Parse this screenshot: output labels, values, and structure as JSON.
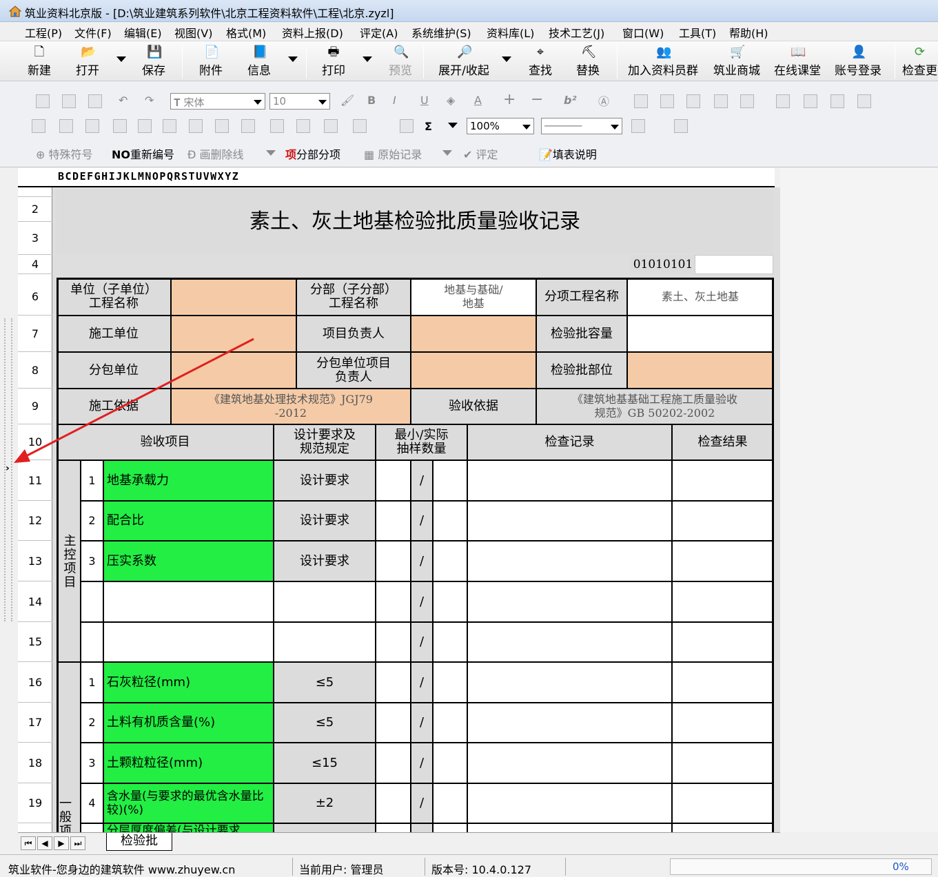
{
  "window": {
    "title": "筑业资料北京版 - [D:\\筑业建筑系列软件\\北京工程资料软件\\工程\\北京.zyzl]"
  },
  "menu": [
    "工程(P)",
    "文件(F)",
    "编辑(E)",
    "视图(V)",
    "格式(M)",
    "资料上报(D)",
    "评定(A)",
    "系统维护(S)",
    "资料库(L)",
    "技术工艺(J)",
    "窗口(W)",
    "工具(T)",
    "帮助(H)"
  ],
  "toolbar": {
    "new": "新建",
    "open": "打开",
    "save": "保存",
    "attach": "附件",
    "info": "信息",
    "print": "打印",
    "preview": "预览",
    "expand": "展开/收起",
    "find": "查找",
    "replace": "替换",
    "join": "加入资料员群",
    "mall": "筑业商城",
    "course": "在线课堂",
    "login": "账号登录",
    "check": "检查更"
  },
  "format": {
    "font": "宋体",
    "size": "10",
    "zoom": "100%",
    "special": "特殊符号",
    "renumber": "重新编号",
    "strike": "画删除线",
    "split": "分部分项",
    "raw": "原始记录",
    "evaluate": "评定",
    "fill": "填表说明",
    "renumber_icon": "NO",
    "split_icon": "项"
  },
  "sheet": {
    "column_letters": "BCDEFGHIJKLMNOPQRSTUVWXYZ",
    "rows": [
      "2",
      "3",
      "4",
      "6",
      "7",
      "8",
      "9",
      "10",
      "11",
      "12",
      "13",
      "14",
      "15",
      "16",
      "17",
      "18",
      "19"
    ],
    "title": "素土、灰土地基检验批质量验收记录",
    "code": "01010101",
    "unit_label": "单位（子单位）\n工程名称",
    "sub_label": "分部（子分部）\n工程名称",
    "sub_value": "地基与基础/\n地基",
    "item_label": "分项工程名称",
    "item_value": "素土、灰土地基",
    "constr_label": "施工单位",
    "pm_label": "项目负责人",
    "cap_label": "检验批容量",
    "subc_label": "分包单位",
    "subpm_label": "分包单位项目\n负责人",
    "pos_label": "检验批部位",
    "basis_label": "施工依据",
    "basis_value": "《建筑地基处理技术规范》JGJ79\n-2012",
    "acc_label": "验收依据",
    "acc_value": "《建筑地基基础工程施工质量验收\n规范》GB 50202-2002",
    "h_item": "验收项目",
    "h_design": "设计要求及\n规范规定",
    "h_sample": "最小/实际\n抽样数量",
    "h_record": "检查记录",
    "h_result": "检查结果",
    "main_group": "主控项目",
    "gen_group": "一般项",
    "slash": "/",
    "main": [
      {
        "n": "1",
        "name": "地基承载力",
        "req": "设计要求"
      },
      {
        "n": "2",
        "name": "配合比",
        "req": "设计要求"
      },
      {
        "n": "3",
        "name": "压实系数",
        "req": "设计要求"
      }
    ],
    "general": [
      {
        "n": "1",
        "name": "石灰粒径(mm)",
        "req": "≤5"
      },
      {
        "n": "2",
        "name": "土料有机质含量(%)",
        "req": "≤5"
      },
      {
        "n": "3",
        "name": "土颗粒粒径(mm)",
        "req": "≤15"
      },
      {
        "n": "4",
        "name": "含水量(与要求的最优含水量比较)(%)",
        "req": "±2"
      }
    ],
    "cut_row": "分层厚度偏差(与设计要求"
  },
  "tab": {
    "name": "检验批"
  },
  "status": {
    "left": "筑业软件-您身边的建筑软件 www.zhuyew.cn",
    "user": "当前用户: 管理员",
    "version": "版本号: 10.4.0.127",
    "progress": "0%"
  }
}
